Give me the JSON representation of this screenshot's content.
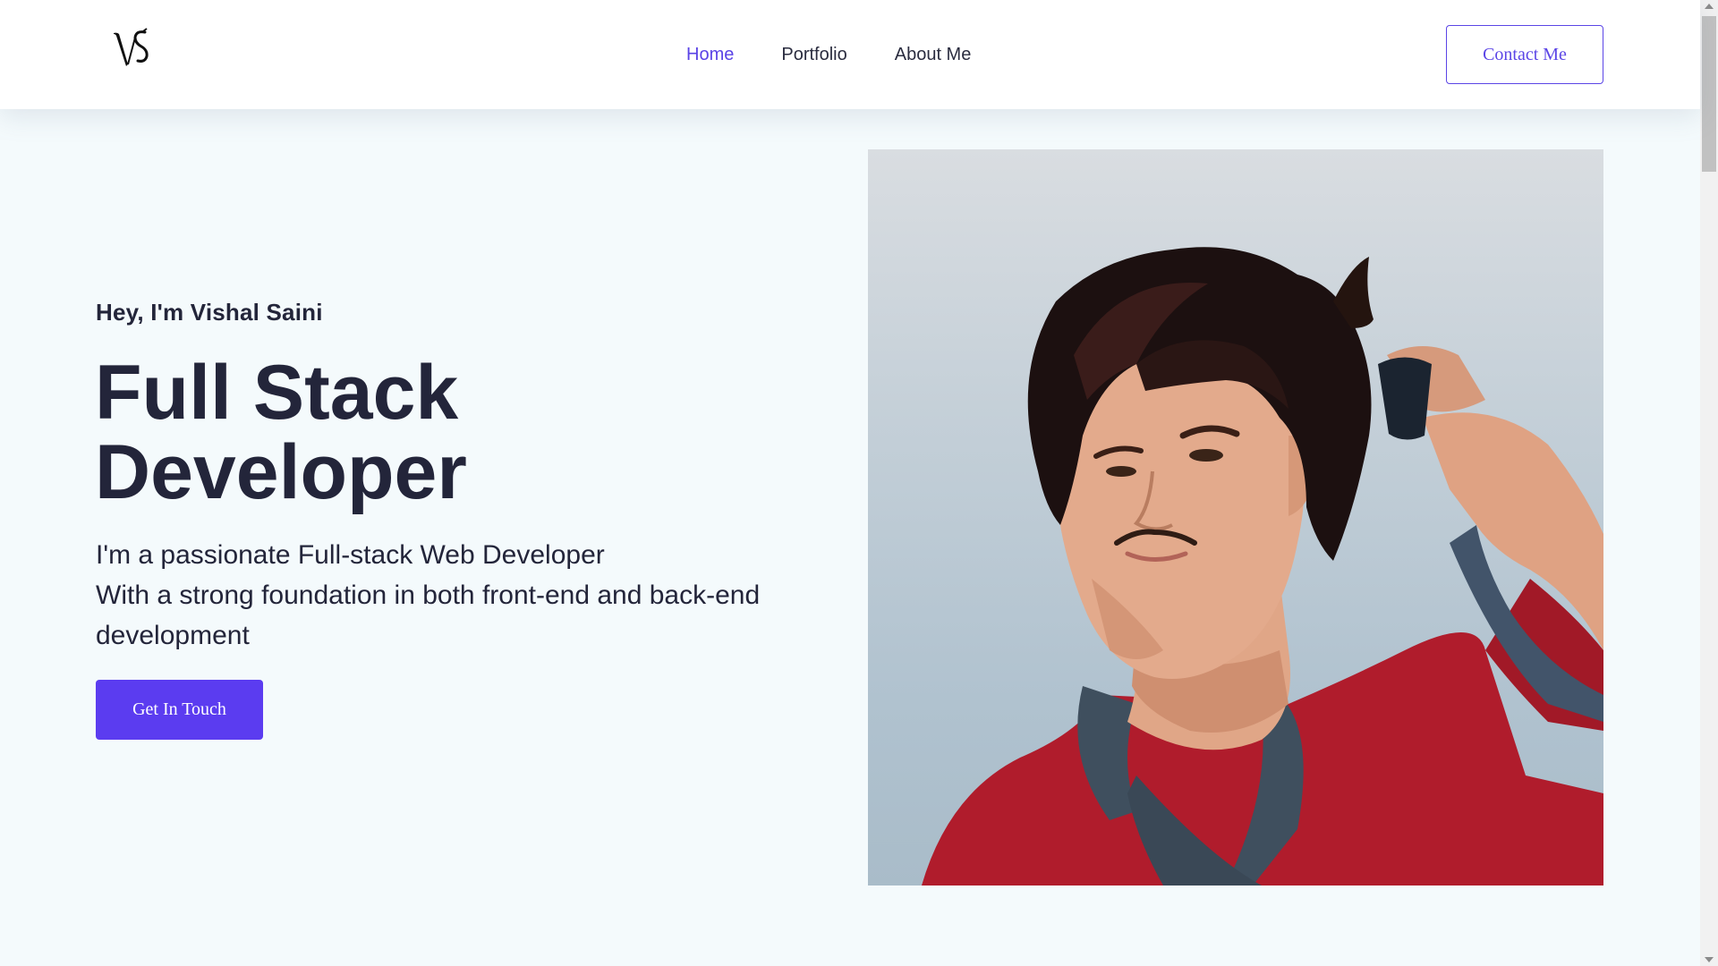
{
  "header": {
    "logo_text": "VS",
    "nav": [
      {
        "label": "Home",
        "active": true
      },
      {
        "label": "Portfolio",
        "active": false
      },
      {
        "label": "About Me",
        "active": false
      }
    ],
    "contact_label": "Contact Me"
  },
  "hero": {
    "greeting": "Hey, I'm Vishal Saini",
    "headline_line1": "Full Stack",
    "headline_line2": "Developer",
    "tagline_line1": "I'm a passionate Full-stack Web Developer",
    "tagline_line2": "With a strong foundation in both front-end and back-end",
    "tagline_line3": "development",
    "cta_label": "Get In Touch"
  },
  "portrait": {
    "subject": "portrait-photo"
  },
  "colors": {
    "accent": "#5b3cf0",
    "text": "#23253a",
    "background": "#f4fafc"
  }
}
